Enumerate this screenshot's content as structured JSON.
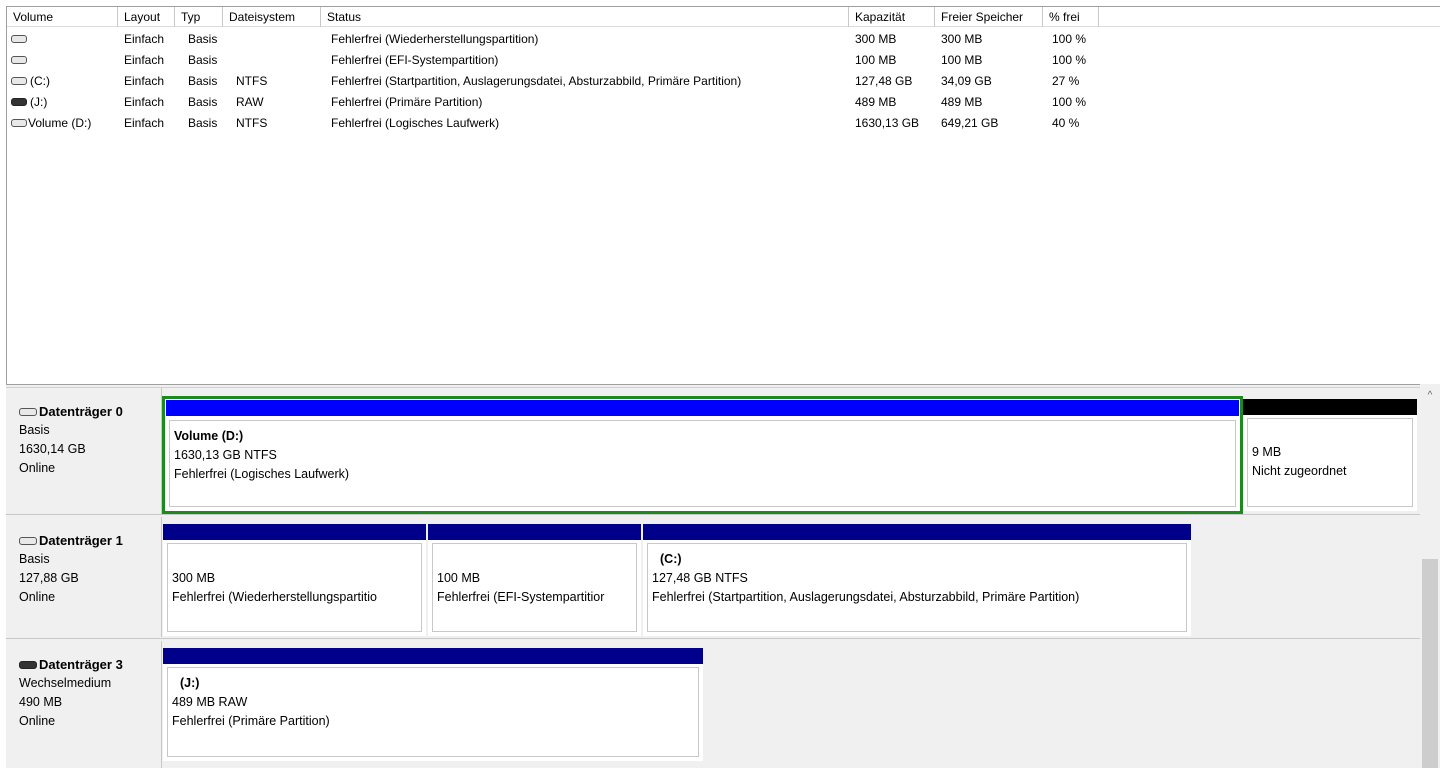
{
  "list": {
    "columns": [
      "Volume",
      "Layout",
      "Typ",
      "Dateisystem",
      "Status",
      "Kapazität",
      "Freier Speicher",
      "% frei"
    ],
    "rows": [
      {
        "icon": "disk-icon",
        "volume": "",
        "layout": "Einfach",
        "typ": "Basis",
        "fs": "",
        "status": "Fehlerfrei (Wiederherstellungspartition)",
        "kap": "300 MB",
        "frei": "300 MB",
        "pct": "100 %"
      },
      {
        "icon": "disk-icon",
        "volume": "",
        "layout": "Einfach",
        "typ": "Basis",
        "fs": "",
        "status": "Fehlerfrei (EFI-Systempartition)",
        "kap": "100 MB",
        "frei": "100 MB",
        "pct": "100 %"
      },
      {
        "icon": "disk-icon",
        "volume": "(C:)",
        "layout": "Einfach",
        "typ": "Basis",
        "fs": "NTFS",
        "status": "Fehlerfrei (Startpartition, Auslagerungsdatei, Absturzabbild, Primäre Partition)",
        "kap": "127,48 GB",
        "frei": "34,09 GB",
        "pct": "27 %"
      },
      {
        "icon": "removable-disk-icon",
        "volume": "(J:)",
        "layout": "Einfach",
        "typ": "Basis",
        "fs": "RAW",
        "status": "Fehlerfrei (Primäre Partition)",
        "kap": "489 MB",
        "frei": "489 MB",
        "pct": "100 %"
      },
      {
        "icon": "disk-icon",
        "volume": "Volume (D:)",
        "layout": "Einfach",
        "typ": "Basis",
        "fs": "NTFS",
        "status": "Fehlerfrei (Logisches Laufwerk)",
        "kap": "1630,13 GB",
        "frei": "649,21 GB",
        "pct": "40 %"
      }
    ]
  },
  "disks": [
    {
      "name": "Datenträger 0",
      "type": "Basis",
      "size": "1630,14 GB",
      "state": "Online",
      "partitions": [
        {
          "title": "Volume  (D:)",
          "line1": "1630,13 GB NTFS",
          "line2": "Fehlerfrei (Logisches Laufwerk)",
          "bar_color": "#0000ff",
          "selected": true
        },
        {
          "title": "",
          "line1": "9 MB",
          "line2": "Nicht zugeordnet",
          "bar_color": "#000000"
        }
      ]
    },
    {
      "name": "Datenträger 1",
      "type": "Basis",
      "size": "127,88 GB",
      "state": "Online",
      "partitions": [
        {
          "title": "",
          "line1": "300 MB",
          "line2": "Fehlerfrei (Wiederherstellungspartitio",
          "bar_color": "#00008b"
        },
        {
          "title": "",
          "line1": "100 MB",
          "line2": "Fehlerfrei (EFI-Systempartitior",
          "bar_color": "#00008b"
        },
        {
          "title": "(C:)",
          "line1": "127,48 GB NTFS",
          "line2": "Fehlerfrei (Startpartition, Auslagerungsdatei, Absturzabbild, Primäre Partition)",
          "bar_color": "#00008b"
        }
      ]
    },
    {
      "name": "Datenträger 3",
      "type": "Wechselmedium",
      "size": "490 MB",
      "state": "Online",
      "partitions": [
        {
          "title": "(J:)",
          "line1": "489 MB RAW",
          "line2": "Fehlerfrei (Primäre Partition)",
          "bar_color": "#00008b"
        }
      ]
    }
  ],
  "scrollbar": {
    "up_glyph": "^"
  }
}
